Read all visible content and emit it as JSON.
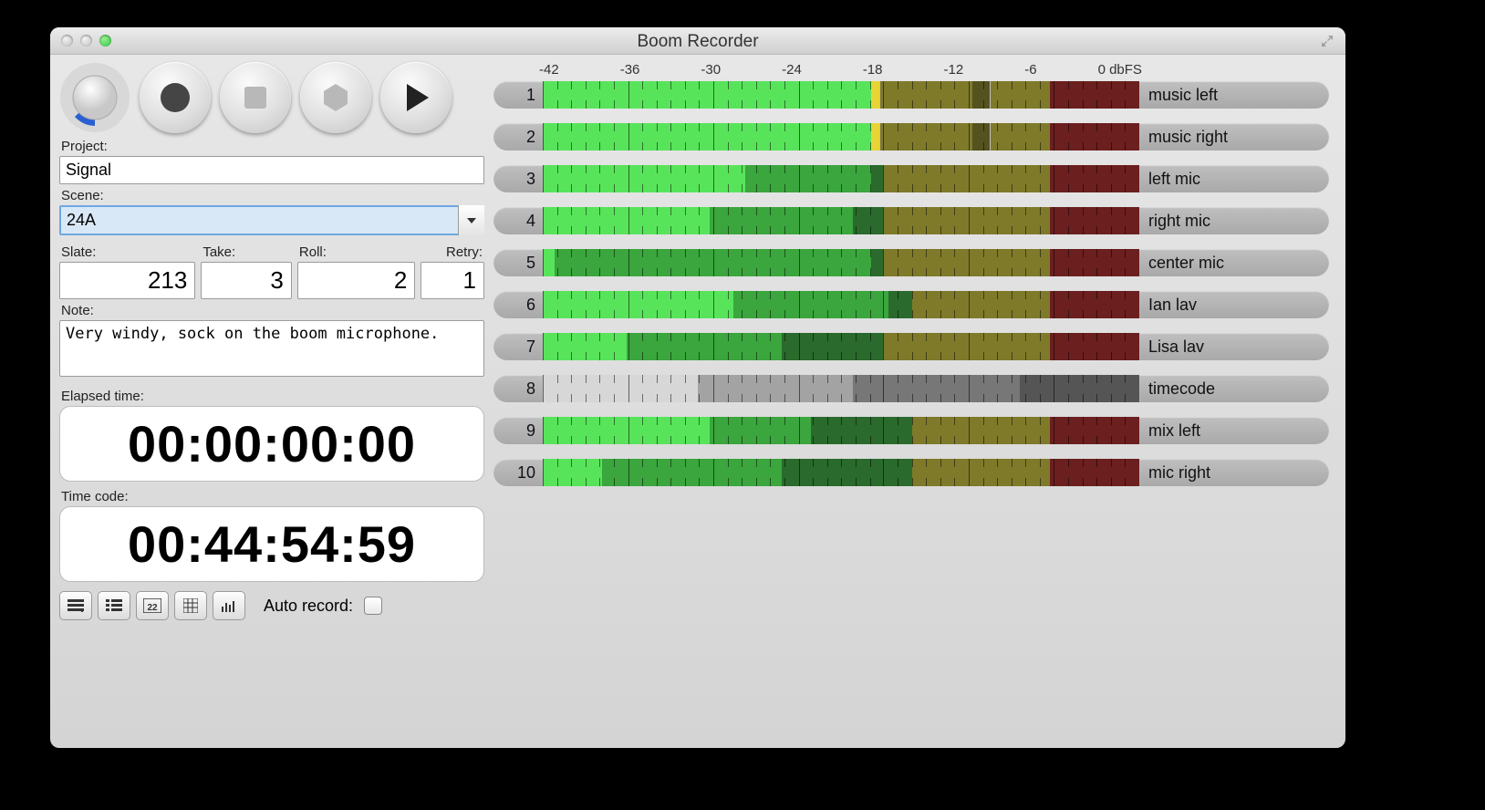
{
  "window": {
    "title": "Boom Recorder"
  },
  "form": {
    "project_label": "Project:",
    "project_value": "Signal",
    "scene_label": "Scene:",
    "scene_value": "24A",
    "slate_label": "Slate:",
    "slate_value": "213",
    "take_label": "Take:",
    "take_value": "3",
    "roll_label": "Roll:",
    "roll_value": "2",
    "retry_label": "Retry:",
    "retry_value": "1",
    "note_label": "Note:",
    "note_value": "Very windy, sock on the boom microphone.",
    "elapsed_label": "Elapsed time:",
    "elapsed_value": "00:00:00:00",
    "timecode_label": "Time code:",
    "timecode_value": "00:44:54:59",
    "auto_record_label": "Auto record:"
  },
  "scale": {
    "ticks": [
      "-42",
      "-36",
      "-30",
      "-24",
      "-18",
      "-12",
      "-6",
      "0 dbFS"
    ]
  },
  "palette": {
    "bright_green": "#58e45a",
    "mid_green": "#3aa63d",
    "dark_green": "#2a6a2c",
    "yellow": "#e7d437",
    "olive": "#7f7a2a",
    "dark_olive": "#54521f",
    "red": "#6c1f1f",
    "grey_light": "#d7d7d7",
    "grey_mid": "#a3a3a3",
    "grey_dark": "#777777",
    "grey_darker": "#555555"
  },
  "channels": [
    {
      "num": "1",
      "name": "music left",
      "segments": [
        {
          "from": 0,
          "to": 55,
          "c": "bright_green"
        },
        {
          "from": 55,
          "to": 56.5,
          "c": "yellow"
        },
        {
          "from": 56.5,
          "to": 72,
          "c": "olive"
        },
        {
          "from": 72,
          "to": 75,
          "c": "dark_olive"
        },
        {
          "from": 75,
          "to": 85,
          "c": "olive"
        },
        {
          "from": 85,
          "to": 100,
          "c": "red"
        }
      ]
    },
    {
      "num": "2",
      "name": "music right",
      "segments": [
        {
          "from": 0,
          "to": 55,
          "c": "bright_green"
        },
        {
          "from": 55,
          "to": 56.5,
          "c": "yellow"
        },
        {
          "from": 56.5,
          "to": 72,
          "c": "olive"
        },
        {
          "from": 72,
          "to": 75,
          "c": "dark_olive"
        },
        {
          "from": 75,
          "to": 85,
          "c": "olive"
        },
        {
          "from": 85,
          "to": 100,
          "c": "red"
        }
      ]
    },
    {
      "num": "3",
      "name": "left mic",
      "segments": [
        {
          "from": 0,
          "to": 34,
          "c": "bright_green"
        },
        {
          "from": 34,
          "to": 36,
          "c": "mid_green"
        },
        {
          "from": 36,
          "to": 55,
          "c": "mid_green"
        },
        {
          "from": 55,
          "to": 57,
          "c": "dark_green"
        },
        {
          "from": 57,
          "to": 85,
          "c": "olive"
        },
        {
          "from": 85,
          "to": 100,
          "c": "red"
        }
      ]
    },
    {
      "num": "4",
      "name": "right mic",
      "segments": [
        {
          "from": 0,
          "to": 28,
          "c": "bright_green"
        },
        {
          "from": 28,
          "to": 30,
          "c": "mid_green"
        },
        {
          "from": 30,
          "to": 52,
          "c": "mid_green"
        },
        {
          "from": 52,
          "to": 57,
          "c": "dark_green"
        },
        {
          "from": 57,
          "to": 85,
          "c": "olive"
        },
        {
          "from": 85,
          "to": 100,
          "c": "red"
        }
      ]
    },
    {
      "num": "5",
      "name": "center mic",
      "segments": [
        {
          "from": 0,
          "to": 2,
          "c": "bright_green"
        },
        {
          "from": 2,
          "to": 20,
          "c": "mid_green"
        },
        {
          "from": 20,
          "to": 55,
          "c": "mid_green"
        },
        {
          "from": 55,
          "to": 57,
          "c": "dark_green"
        },
        {
          "from": 57,
          "to": 85,
          "c": "olive"
        },
        {
          "from": 85,
          "to": 100,
          "c": "red"
        }
      ]
    },
    {
      "num": "6",
      "name": "Ian lav",
      "segments": [
        {
          "from": 0,
          "to": 32,
          "c": "bright_green"
        },
        {
          "from": 32,
          "to": 34,
          "c": "mid_green"
        },
        {
          "from": 34,
          "to": 58,
          "c": "mid_green"
        },
        {
          "from": 58,
          "to": 62,
          "c": "dark_green"
        },
        {
          "from": 62,
          "to": 85,
          "c": "olive"
        },
        {
          "from": 85,
          "to": 100,
          "c": "red"
        }
      ]
    },
    {
      "num": "7",
      "name": "Lisa lav",
      "segments": [
        {
          "from": 0,
          "to": 14,
          "c": "bright_green"
        },
        {
          "from": 14,
          "to": 16,
          "c": "mid_green"
        },
        {
          "from": 16,
          "to": 40,
          "c": "mid_green"
        },
        {
          "from": 40,
          "to": 57,
          "c": "dark_green"
        },
        {
          "from": 57,
          "to": 85,
          "c": "olive"
        },
        {
          "from": 85,
          "to": 100,
          "c": "red"
        }
      ]
    },
    {
      "num": "8",
      "name": "timecode",
      "segments": [
        {
          "from": 0,
          "to": 26,
          "c": "grey_light"
        },
        {
          "from": 26,
          "to": 28,
          "c": "grey_mid"
        },
        {
          "from": 28,
          "to": 52,
          "c": "grey_mid"
        },
        {
          "from": 52,
          "to": 80,
          "c": "grey_dark"
        },
        {
          "from": 80,
          "to": 100,
          "c": "grey_darker"
        }
      ]
    },
    {
      "num": "9",
      "name": "mix left",
      "segments": [
        {
          "from": 0,
          "to": 28,
          "c": "bright_green"
        },
        {
          "from": 28,
          "to": 30,
          "c": "mid_green"
        },
        {
          "from": 30,
          "to": 45,
          "c": "mid_green"
        },
        {
          "from": 45,
          "to": 62,
          "c": "dark_green"
        },
        {
          "from": 62,
          "to": 85,
          "c": "olive"
        },
        {
          "from": 85,
          "to": 100,
          "c": "red"
        }
      ]
    },
    {
      "num": "10",
      "name": "mic right",
      "segments": [
        {
          "from": 0,
          "to": 10,
          "c": "bright_green"
        },
        {
          "from": 10,
          "to": 12,
          "c": "mid_green"
        },
        {
          "from": 12,
          "to": 40,
          "c": "mid_green"
        },
        {
          "from": 40,
          "to": 62,
          "c": "dark_green"
        },
        {
          "from": 62,
          "to": 85,
          "c": "olive"
        },
        {
          "from": 85,
          "to": 100,
          "c": "red"
        }
      ]
    }
  ]
}
